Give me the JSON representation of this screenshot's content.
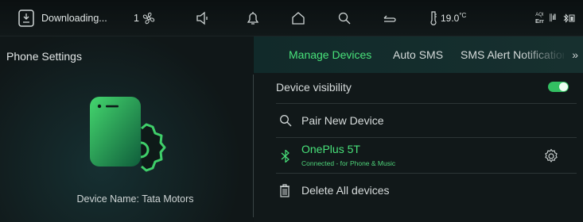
{
  "status_bar": {
    "download_text": "Downloading...",
    "fan_speed": "1",
    "temperature": "19.0",
    "temperature_unit": "°C",
    "aqi_label": "AQI",
    "aqi_value": "Err",
    "signal_text": "∥ıll",
    "icons": [
      "download-icon",
      "fan-icon",
      "volume-icon",
      "bell-icon",
      "home-icon",
      "search-icon",
      "return-icon",
      "thermometer-icon",
      "signal-icon",
      "bluetooth-battery-icon"
    ]
  },
  "left_panel": {
    "title": "Phone Settings",
    "device_name": "Device Name: Tata Motors"
  },
  "tabs": [
    {
      "label": "Manage Devices",
      "active": true
    },
    {
      "label": "Auto SMS",
      "active": false
    },
    {
      "label": "SMS Alert Notifications",
      "active": false
    }
  ],
  "tabs_more": "»",
  "list": {
    "device_visibility_label": "Device visibility",
    "device_visibility_on": true,
    "pair_new_label": "Pair New Device",
    "device": {
      "name": "OnePlus 5T",
      "status": "Connected - for Phone & Music"
    },
    "delete_all_label": "Delete All devices"
  },
  "colors": {
    "accent_green": "#48e27a",
    "background": "#0f1516",
    "tab_bar": "#17302f",
    "divider": "#2c3536"
  }
}
